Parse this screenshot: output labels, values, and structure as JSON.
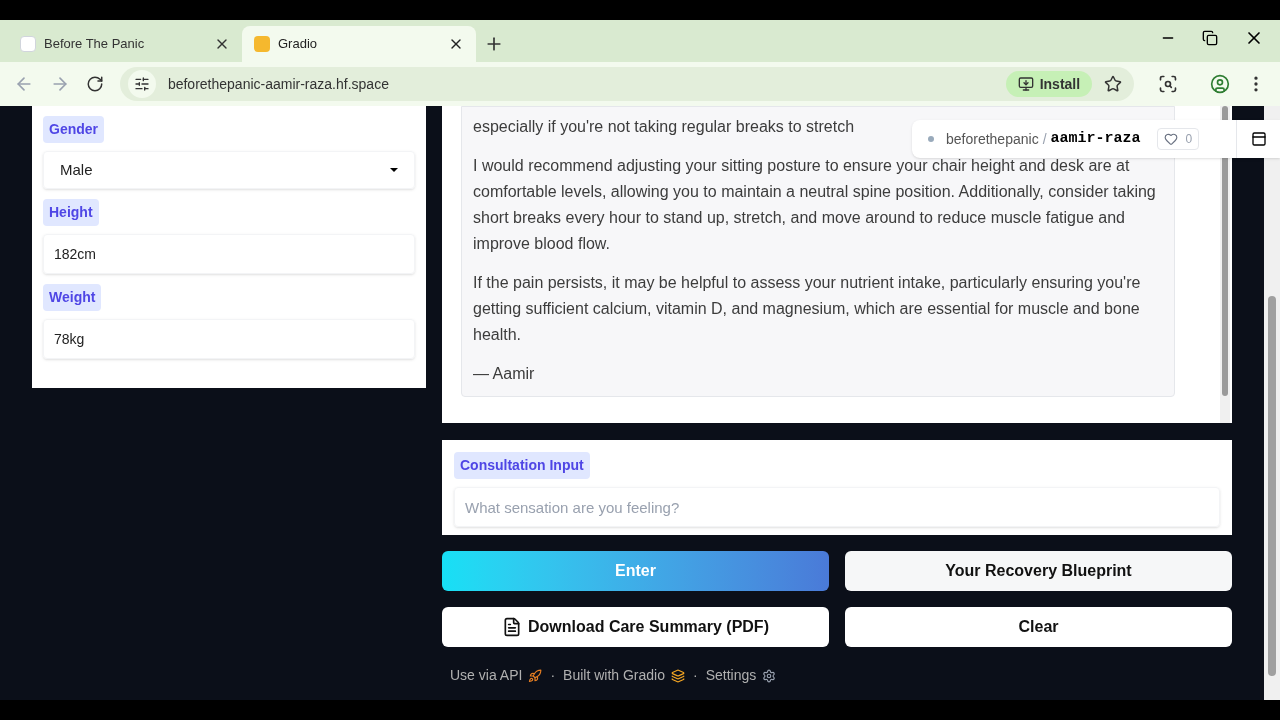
{
  "browser": {
    "tabs": [
      {
        "title": "Before The Panic",
        "selected": false
      },
      {
        "title": "Gradio",
        "selected": true
      }
    ],
    "url": "beforethepanic-aamir-raza.hf.space",
    "install_label": "Install"
  },
  "profile_fields": [
    {
      "label": "Gender",
      "value": "Male",
      "kind": "dropdown"
    },
    {
      "label": "Height",
      "value": "182cm",
      "kind": "text"
    },
    {
      "label": "Weight",
      "value": "78kg",
      "kind": "text"
    }
  ],
  "chat": {
    "paragraphs": [
      "especially if you're not taking regular breaks to stretch",
      "I would recommend adjusting your sitting posture to ensure your chair height and desk are at comfortable levels, allowing you to maintain a neutral spine position. Additionally, consider taking short breaks every hour to stand up, stretch, and move around to reduce muscle fatigue and improve blood flow.",
      "If the pain persists, it may be helpful to assess your nutrient intake, particularly ensuring you're getting sufficient calcium, vitamin D, and magnesium, which are essential for muscle and bone health.",
      "— Aamir"
    ]
  },
  "space_badge": {
    "owner": "beforethepanic",
    "separator": "/",
    "name": "aamir-raza",
    "likes": "0"
  },
  "consultation": {
    "label": "Consultation Input",
    "placeholder": "What sensation are you feeling?"
  },
  "buttons": [
    {
      "label": "Enter",
      "kind": "primary"
    },
    {
      "label": "Your Recovery Blueprint",
      "kind": "secondary"
    },
    {
      "label": "Download Care Summary (PDF)",
      "kind": "download"
    },
    {
      "label": "Clear",
      "kind": "plain"
    }
  ],
  "footer": [
    {
      "label": "Use via API",
      "kind": "api"
    },
    {
      "label": "Built with Gradio",
      "kind": "gradio"
    },
    {
      "label": "Settings",
      "kind": "settings"
    }
  ],
  "footer_separator": "·"
}
